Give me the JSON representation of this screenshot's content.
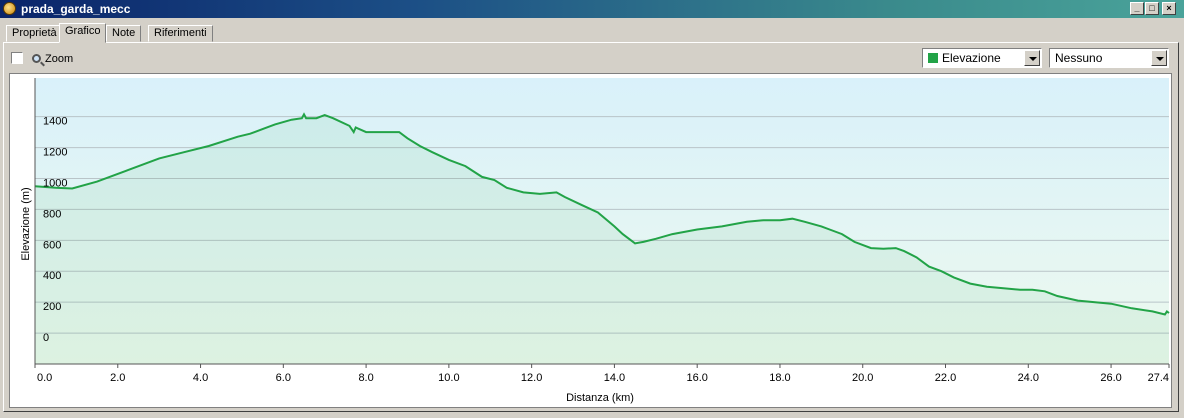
{
  "window": {
    "title": "prada_garda_mecc"
  },
  "tabs": [
    {
      "label": "Proprietà",
      "active": false
    },
    {
      "label": "Grafico",
      "active": true
    },
    {
      "label": "Note",
      "active": false
    },
    {
      "label": "Riferimenti",
      "active": false
    }
  ],
  "toolbar": {
    "zoom_label": "Zoom",
    "zoom_checked": false,
    "series_select": {
      "value": "Elevazione",
      "swatch_color": "#22a347"
    },
    "secondary_select": {
      "value": "Nessuno"
    }
  },
  "chart_data": {
    "type": "area",
    "xlabel": "Distanza  (km)",
    "ylabel": "Elevazione (m)",
    "xlim": [
      0,
      27.4
    ],
    "ylim": [
      -200,
      1650
    ],
    "xticks": [
      "0.0",
      "2.0",
      "4.0",
      "6.0",
      "8.0",
      "10.0",
      "12.0",
      "14.0",
      "16.0",
      "18.0",
      "20.0",
      "22.0",
      "24.0",
      "26.0",
      "27.4"
    ],
    "yticks": [
      "0",
      "200",
      "400",
      "600",
      "800",
      "1000",
      "1200",
      "1400"
    ],
    "grid": true,
    "line_color": "#22a347",
    "series": [
      {
        "x": [
          0,
          0.5,
          0.9,
          1.5,
          2.2,
          3,
          3.6,
          4.2,
          4.9,
          5.2,
          5.8,
          6.2,
          6.45,
          6.5,
          6.55,
          6.8,
          7,
          7.2,
          7.6,
          7.7,
          7.75,
          8,
          8.4,
          8.8,
          9,
          9.3,
          9.6,
          10,
          10.4,
          10.8,
          11.1,
          11.4,
          11.8,
          12.2,
          12.6,
          12.8,
          13.2,
          13.6,
          14,
          14.2,
          14.5,
          14.7,
          15,
          15.4,
          16,
          16.6,
          17.2,
          17.6,
          18,
          18.3,
          18.6,
          19,
          19.2,
          19.5,
          19.8,
          20.2,
          20.5,
          20.8,
          21,
          21.3,
          21.6,
          21.9,
          22.2,
          22.6,
          23,
          23.4,
          23.8,
          24.1,
          24.4,
          24.7,
          25.2,
          26,
          26.5,
          27,
          27.3,
          27.35,
          27.4
        ],
        "y": [
          950,
          940,
          935,
          980,
          1050,
          1130,
          1170,
          1210,
          1270,
          1290,
          1350,
          1380,
          1390,
          1415,
          1390,
          1390,
          1410,
          1390,
          1340,
          1300,
          1330,
          1300,
          1300,
          1300,
          1260,
          1210,
          1170,
          1120,
          1080,
          1010,
          990,
          940,
          910,
          900,
          910,
          880,
          830,
          780,
          690,
          640,
          580,
          590,
          610,
          640,
          670,
          690,
          720,
          730,
          730,
          740,
          720,
          690,
          670,
          640,
          590,
          550,
          545,
          550,
          530,
          490,
          430,
          400,
          360,
          320,
          300,
          290,
          280,
          280,
          270,
          240,
          210,
          190,
          160,
          140,
          120,
          140,
          130
        ]
      }
    ]
  }
}
